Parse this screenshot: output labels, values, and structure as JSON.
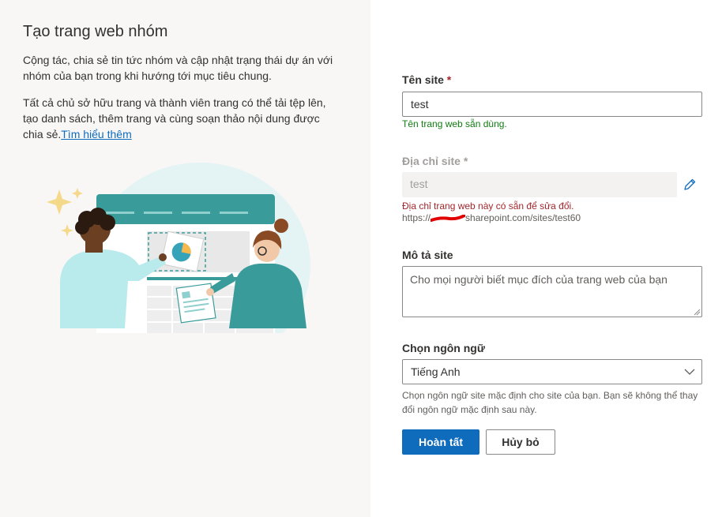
{
  "panel": {
    "title": "Tạo trang web nhóm",
    "description1": "Cộng tác, chia sẻ tin tức nhóm và cập nhật trạng thái dự án với nhóm của bạn trong khi hướng tới mục tiêu chung.",
    "description2": "Tất cả chủ sở hữu trang và thành viên trang có thể tải tệp lên, tạo danh sách, thêm trang và cùng soạn thảo nội dung được chia sẻ.",
    "learn_more": "Tìm hiểu thêm"
  },
  "form": {
    "site_name": {
      "label": "Tên site",
      "required": "*",
      "value": "test",
      "status": "Tên trang web sẵn dùng."
    },
    "site_address": {
      "label": "Địa chỉ site",
      "required": "*",
      "value": "test",
      "error": "Địa chỉ trang web này có sẵn để sửa đổi.",
      "url_prefix": "https://",
      "url_suffix": "sharepoint.com/sites/test60"
    },
    "site_description": {
      "label": "Mô tả site",
      "placeholder": "Cho mọi người biết mục đích của trang web của bạn"
    },
    "language": {
      "label": "Chọn ngôn ngữ",
      "selected": "Tiếng Anh",
      "help": "Chọn ngôn ngữ site mặc định cho site của bạn. Bạn sẽ không thể thay đổi ngôn ngữ mặc định sau này."
    },
    "buttons": {
      "finish": "Hoàn tất",
      "cancel": "Hủy bỏ"
    }
  },
  "colors": {
    "primary": "#0f6cbd",
    "success": "#107c10",
    "error": "#a4262c",
    "redaction": "#e00000",
    "panel_bg": "#f8f7f6"
  },
  "icons": {
    "edit": "pencil-icon",
    "dropdown": "chevron-down-icon"
  }
}
